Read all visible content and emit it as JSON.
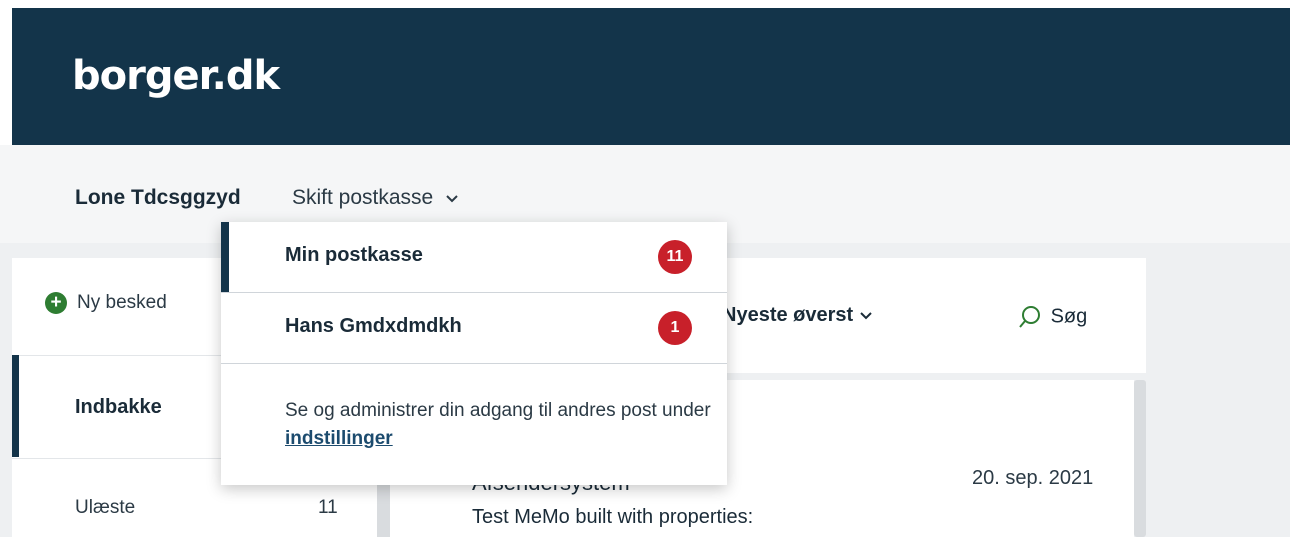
{
  "header": {
    "logo": "borger.dk"
  },
  "userbar": {
    "user_name": "Lone Tdcsggzyd",
    "switch_label": "Skift postkasse"
  },
  "sidebar": {
    "new_message": "Ny besked",
    "inbox": "Indbakke",
    "unread_label": "Ulæste",
    "unread_count": "11"
  },
  "toolbar": {
    "sort_label": "Nyeste øverst",
    "search_label": "Søg"
  },
  "message": {
    "sender": "Afsendersystem",
    "date": "20. sep. 2021",
    "subject": "Test MeMo built with properties:"
  },
  "dropdown": {
    "items": [
      {
        "label": "Min postkasse",
        "badge": "11"
      },
      {
        "label": "Hans Gmdxdmdkh",
        "badge": "1"
      }
    ],
    "info_text": "Se og administrer din adgang til andres post under ",
    "info_link": "indstillinger"
  },
  "colors": {
    "header_bg": "#13344a",
    "badge": "#c8202a",
    "plus": "#2e7d32"
  }
}
